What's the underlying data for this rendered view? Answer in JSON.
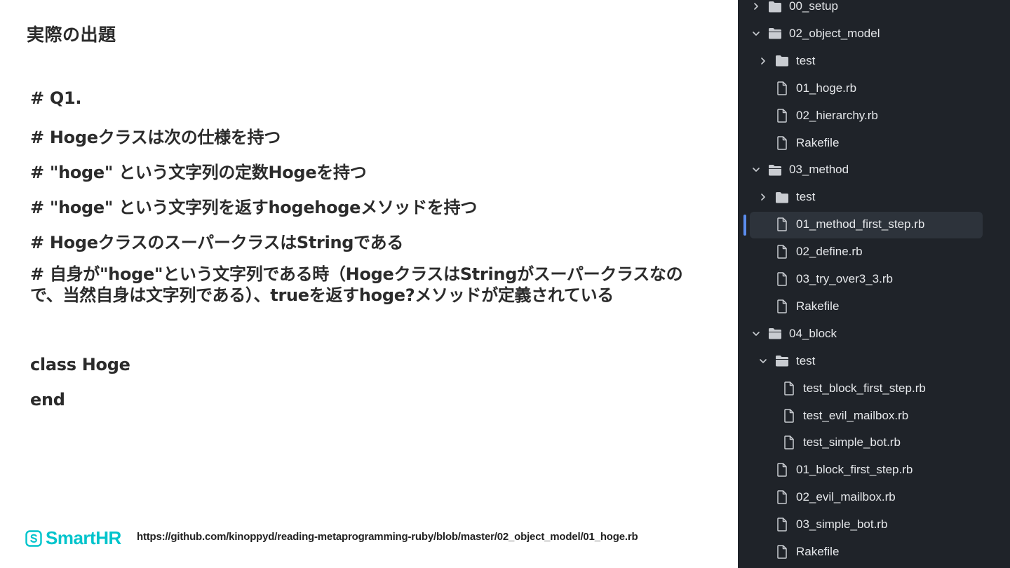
{
  "slide": {
    "title": "実際の出題",
    "code_lines": [
      "# Q1.",
      "# Hogeクラスは次の仕様を持つ",
      "# \"hoge\" という文字列の定数Hogeを持つ",
      "# \"hoge\" という文字列を返すhogehogeメソッドを持つ",
      "# HogeクラスのスーパークラスはStringである",
      "# 自身が\"hoge\"という文字列である時（HogeクラスはStringがスーパークラスなので、当然自身は文字列である）、trueを返すhoge?メソッドが定義されている",
      "class Hoge",
      "end"
    ],
    "footer": {
      "logo_text": "SmartHR",
      "url": "https://github.com/kinoppyd/reading-metaprogramming-ruby/blob/master/02_object_model/01_hoge.rb"
    }
  },
  "tree": {
    "items": [
      {
        "label": "00_setup",
        "type": "folder",
        "expanded": false,
        "depth": 0
      },
      {
        "label": "02_object_model",
        "type": "folder",
        "expanded": true,
        "depth": 0
      },
      {
        "label": "test",
        "type": "folder",
        "expanded": false,
        "depth": 1
      },
      {
        "label": "01_hoge.rb",
        "type": "file",
        "depth": 1
      },
      {
        "label": "02_hierarchy.rb",
        "type": "file",
        "depth": 1
      },
      {
        "label": "Rakefile",
        "type": "file",
        "depth": 1
      },
      {
        "label": "03_method",
        "type": "folder",
        "expanded": true,
        "depth": 0
      },
      {
        "label": "test",
        "type": "folder",
        "expanded": false,
        "depth": 1
      },
      {
        "label": "01_method_first_step.rb",
        "type": "file",
        "depth": 1,
        "selected": true
      },
      {
        "label": "02_define.rb",
        "type": "file",
        "depth": 1
      },
      {
        "label": "03_try_over3_3.rb",
        "type": "file",
        "depth": 1
      },
      {
        "label": "Rakefile",
        "type": "file",
        "depth": 1
      },
      {
        "label": "04_block",
        "type": "folder",
        "expanded": true,
        "depth": 0
      },
      {
        "label": "test",
        "type": "folder",
        "expanded": true,
        "depth": 1
      },
      {
        "label": "test_block_first_step.rb",
        "type": "file",
        "depth": 2
      },
      {
        "label": "test_evil_mailbox.rb",
        "type": "file",
        "depth": 2
      },
      {
        "label": "test_simple_bot.rb",
        "type": "file",
        "depth": 2
      },
      {
        "label": "01_block_first_step.rb",
        "type": "file",
        "depth": 1
      },
      {
        "label": "02_evil_mailbox.rb",
        "type": "file",
        "depth": 1
      },
      {
        "label": "03_simple_bot.rb",
        "type": "file",
        "depth": 1
      },
      {
        "label": "Rakefile",
        "type": "file",
        "depth": 1
      }
    ],
    "colors": {
      "background": "#1f2329",
      "selected": "#2d333b",
      "accent": "#5b8def",
      "text": "#e6e8eb",
      "icon": "#c9ccd1"
    }
  }
}
